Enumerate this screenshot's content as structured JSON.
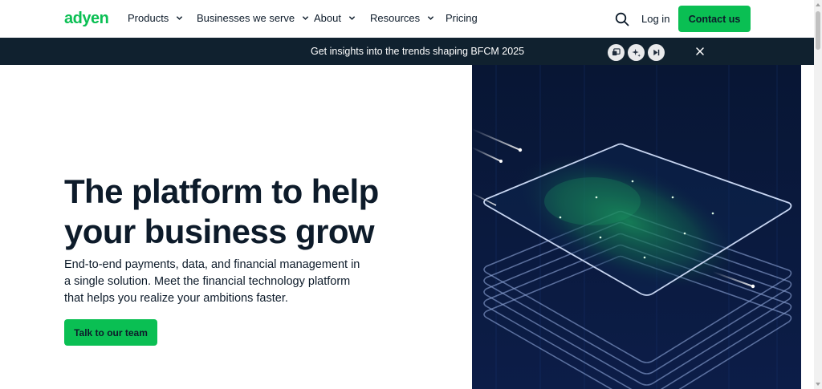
{
  "header": {
    "logo_text": "adyen",
    "nav": [
      {
        "label": "Products",
        "has_dropdown": true
      },
      {
        "label": "Businesses we serve",
        "has_dropdown": true
      },
      {
        "label": "About",
        "has_dropdown": true
      },
      {
        "label": "Resources",
        "has_dropdown": true
      },
      {
        "label": "Pricing",
        "has_dropdown": false
      }
    ],
    "search_icon": "search-icon",
    "login_label": "Log in",
    "contact_label": "Contact us"
  },
  "banner": {
    "text": "Get insights into the trends shaping BFCM 2025",
    "extension_icons": [
      "picture-in-picture-icon",
      "sparkle-icon",
      "skip-icon"
    ],
    "close_icon": "close-icon"
  },
  "hero": {
    "title_line1": "The platform to help",
    "title_line2": "your business grow",
    "subtitle": "End-to-end payments, data, and financial management in a single solution. Meet the financial technology platform that helps you realize your ambitions faster.",
    "cta_label": "Talk to our team"
  },
  "colors": {
    "brand_green": "#0abf53",
    "banner_bg": "#10212f",
    "text_dark": "#0d1b2a",
    "visual_bg": "#0a1a3f"
  }
}
